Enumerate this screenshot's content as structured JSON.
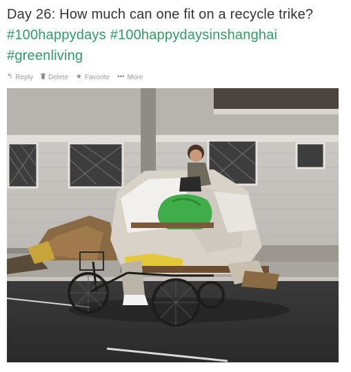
{
  "tweet": {
    "text_prefix": "Day 26: How much can one fit on a recycle trike?",
    "hashtags": [
      "#100happydays",
      "#100happydaysinshanghai",
      "#greenliving"
    ]
  },
  "actions": {
    "reply": "Reply",
    "delete": "Delete",
    "favorite": "Favorite",
    "more": "More"
  },
  "icons": {
    "reply": "reply-arrow-icon",
    "delete": "trash-icon",
    "favorite": "star-icon",
    "more": "ellipsis-icon"
  },
  "colors": {
    "text": "#333333",
    "hashtag": "#2c9d63",
    "action": "#9a9a9a"
  }
}
